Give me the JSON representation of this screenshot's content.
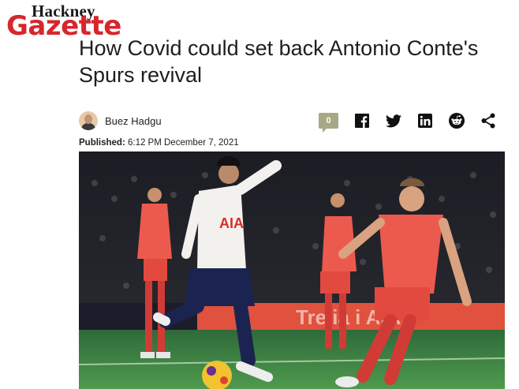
{
  "brand": {
    "top": "Hackney",
    "main": "Gazette"
  },
  "article": {
    "headline": "How Covid could set back Antonio Conte's Spurs revival",
    "author": "Buez Hadgu",
    "published_label": "Published:",
    "published_value": "6:12 PM December 7, 2021",
    "image_alt": "Football match photo: Tottenham player shooting as Norwich players chase",
    "shirt_sponsor": "AIA",
    "board_text": "Tre  ia  i  AIA"
  },
  "share": {
    "comment_count": "0",
    "icons": [
      "facebook-icon",
      "twitter-icon",
      "linkedin-icon",
      "reddit-icon",
      "share-icon"
    ]
  },
  "colors": {
    "brand_red": "#d7262c",
    "comment_badge": "#a5a985",
    "icon_dark": "#111111"
  }
}
